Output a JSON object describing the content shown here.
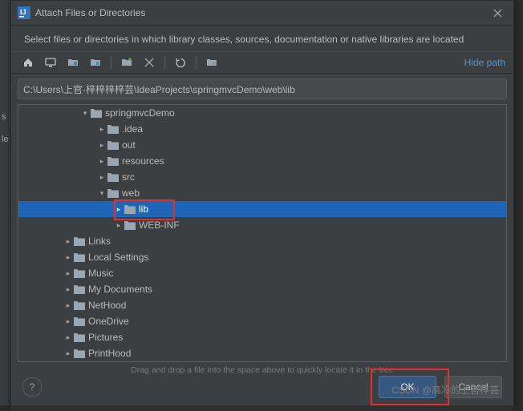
{
  "title": "Attach Files or Directories",
  "subtitle": "Select files or directories in which library classes, sources, documentation or native libraries are located",
  "hide_path_label": "Hide path",
  "path_value": "C:\\Users\\上官·梓梓梓梓芸\\IdeaProjects\\springmvcDemo\\web\\lib",
  "toolbar_icons": [
    "home",
    "desktop",
    "project-dir",
    "module-dir",
    "new-folder",
    "delete",
    "refresh",
    "show-hidden"
  ],
  "tree": [
    {
      "indent": 78,
      "arrow": "down",
      "label": "springmvcDemo"
    },
    {
      "indent": 99,
      "arrow": "right",
      "label": ".idea"
    },
    {
      "indent": 99,
      "arrow": "right",
      "label": "out"
    },
    {
      "indent": 99,
      "arrow": "right",
      "label": "resources"
    },
    {
      "indent": 99,
      "arrow": "right",
      "label": "src"
    },
    {
      "indent": 99,
      "arrow": "down",
      "label": "web"
    },
    {
      "indent": 120,
      "arrow": "right",
      "label": "lib",
      "selected": true
    },
    {
      "indent": 120,
      "arrow": "right",
      "label": "WEB-INF"
    },
    {
      "indent": 57,
      "arrow": "right",
      "label": "Links"
    },
    {
      "indent": 57,
      "arrow": "right",
      "label": "Local Settings"
    },
    {
      "indent": 57,
      "arrow": "right",
      "label": "Music"
    },
    {
      "indent": 57,
      "arrow": "right",
      "label": "My Documents"
    },
    {
      "indent": 57,
      "arrow": "right",
      "label": "NetHood"
    },
    {
      "indent": 57,
      "arrow": "right",
      "label": "OneDrive"
    },
    {
      "indent": 57,
      "arrow": "right",
      "label": "Pictures"
    },
    {
      "indent": 57,
      "arrow": "right",
      "label": "PrintHood"
    }
  ],
  "drag_hint": "Drag and drop a file into the space above to quickly locate it in the tree",
  "buttons": {
    "ok": "OK",
    "cancel": "Cancel"
  },
  "help_label": "?",
  "left_text_1": "s",
  "left_text_2": "le",
  "watermark": "CSDN @高冷的上官梓芸"
}
